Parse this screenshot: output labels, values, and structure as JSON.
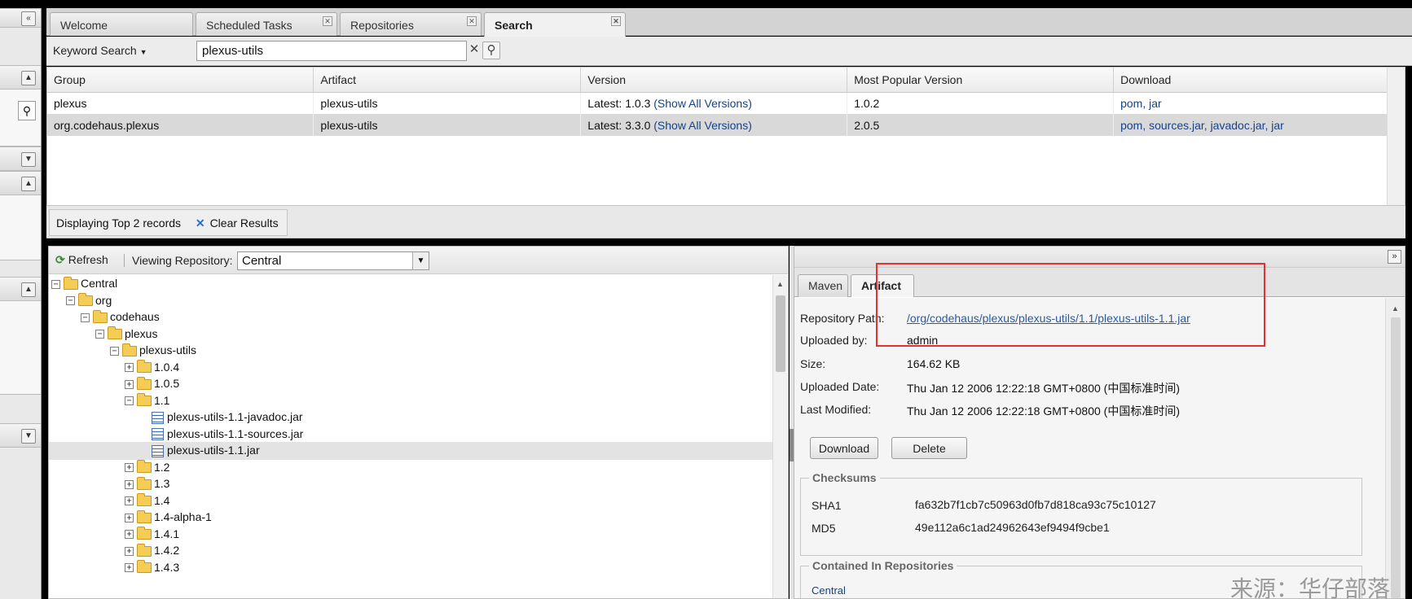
{
  "tabs": [
    {
      "label": "Welcome",
      "closable": false
    },
    {
      "label": "Scheduled Tasks",
      "closable": true
    },
    {
      "label": "Repositories",
      "closable": true
    },
    {
      "label": "Search",
      "closable": true,
      "active": true
    }
  ],
  "search": {
    "mode_label": "Keyword Search",
    "query": "plexus-utils"
  },
  "grid": {
    "columns": [
      "Group",
      "Artifact",
      "Version",
      "Most Popular Version",
      "Download"
    ],
    "rows": [
      {
        "group": "plexus",
        "artifact": "plexus-utils",
        "version_prefix": "Latest: 1.0.3",
        "show_all": "(Show All Versions)",
        "popular": "1.0.2",
        "downloads": "pom, jar"
      },
      {
        "group": "org.codehaus.plexus",
        "artifact": "plexus-utils",
        "version_prefix": "Latest: 3.3.0",
        "show_all": "(Show All Versions)",
        "popular": "2.0.5",
        "downloads": "pom, sources.jar, javadoc.jar, jar",
        "selected": true
      }
    ]
  },
  "status": {
    "text": "Displaying Top 2 records",
    "clear_label": "Clear Results"
  },
  "browser": {
    "refresh_label": "Refresh",
    "viewing_label": "Viewing Repository:",
    "repository": "Central",
    "tree": [
      {
        "label": "Central",
        "level": 0,
        "type": "folder",
        "toggle": "minus"
      },
      {
        "label": "org",
        "level": 1,
        "type": "folder",
        "toggle": "minus"
      },
      {
        "label": "codehaus",
        "level": 2,
        "type": "folder",
        "toggle": "minus"
      },
      {
        "label": "plexus",
        "level": 3,
        "type": "folder",
        "toggle": "minus"
      },
      {
        "label": "plexus-utils",
        "level": 4,
        "type": "folder",
        "toggle": "minus"
      },
      {
        "label": "1.0.4",
        "level": 5,
        "type": "folder",
        "toggle": "plus"
      },
      {
        "label": "1.0.5",
        "level": 5,
        "type": "folder",
        "toggle": "plus"
      },
      {
        "label": "1.1",
        "level": 5,
        "type": "folder",
        "toggle": "minus"
      },
      {
        "label": "plexus-utils-1.1-javadoc.jar",
        "level": 6,
        "type": "file"
      },
      {
        "label": "plexus-utils-1.1-sources.jar",
        "level": 6,
        "type": "file"
      },
      {
        "label": "plexus-utils-1.1.jar",
        "level": 6,
        "type": "file",
        "selected": true
      },
      {
        "label": "1.2",
        "level": 5,
        "type": "folder",
        "toggle": "plus"
      },
      {
        "label": "1.3",
        "level": 5,
        "type": "folder",
        "toggle": "plus"
      },
      {
        "label": "1.4",
        "level": 5,
        "type": "folder",
        "toggle": "plus"
      },
      {
        "label": "1.4-alpha-1",
        "level": 5,
        "type": "folder",
        "toggle": "plus"
      },
      {
        "label": "1.4.1",
        "level": 5,
        "type": "folder",
        "toggle": "plus"
      },
      {
        "label": "1.4.2",
        "level": 5,
        "type": "folder",
        "toggle": "plus"
      },
      {
        "label": "1.4.3",
        "level": 5,
        "type": "folder",
        "toggle": "plus"
      }
    ]
  },
  "detail": {
    "tabs": [
      "Maven",
      "Artifact"
    ],
    "active_tab": "Artifact",
    "fields": {
      "repository_path_label": "Repository Path:",
      "repository_path": "/org/codehaus/plexus/plexus-utils/1.1/plexus-utils-1.1.jar",
      "uploaded_by_label": "Uploaded by:",
      "uploaded_by": "admin",
      "size_label": "Size:",
      "size": "164.62 KB",
      "uploaded_date_label": "Uploaded Date:",
      "uploaded_date": "Thu Jan 12 2006 12:22:18 GMT+0800 (中国标准时间)",
      "last_modified_label": "Last Modified:",
      "last_modified": "Thu Jan 12 2006 12:22:18 GMT+0800 (中国标准时间)"
    },
    "download_label": "Download",
    "delete_label": "Delete",
    "checksums": {
      "title": "Checksums",
      "sha1_label": "SHA1",
      "sha1": "fa632b7f1cb7c50963d0fb7d818ca93c75c10127",
      "md5_label": "MD5",
      "md5": "49e112a6c1ad24962643ef9494f9cbe1"
    },
    "contained": {
      "title": "Contained In Repositories",
      "first": "Central"
    }
  },
  "watermark": "来源：华仔部落",
  "colors": {
    "highlight": "#e53030",
    "link": "#15428b",
    "selected_row": "#d9d9d9"
  }
}
